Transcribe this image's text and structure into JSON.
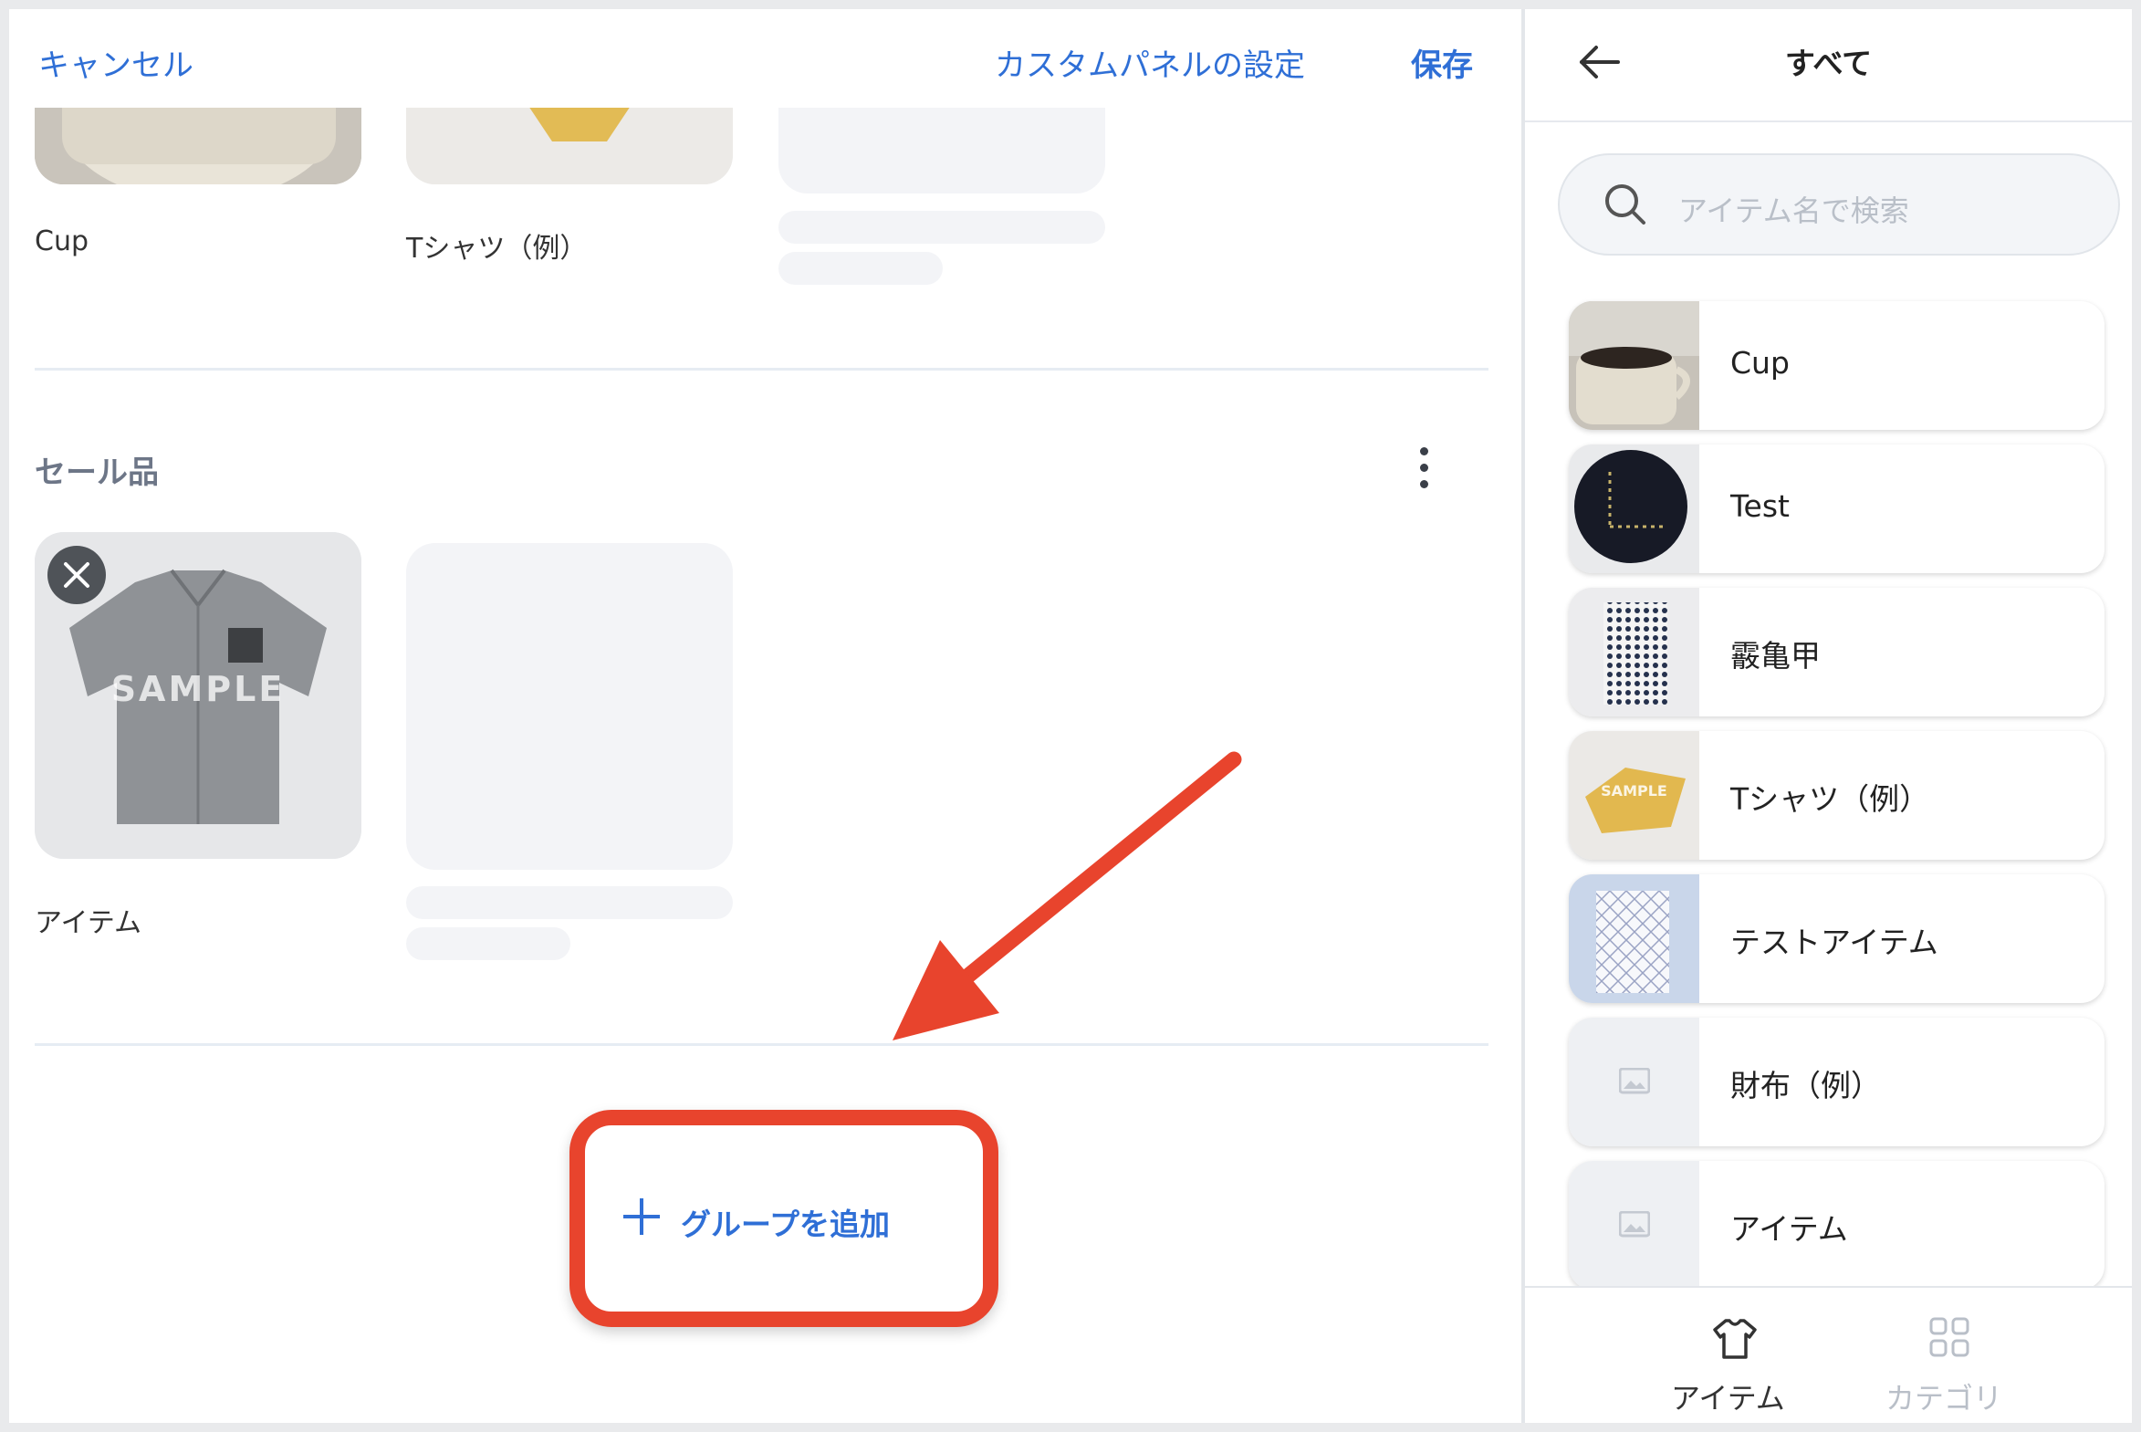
{
  "header": {
    "cancel_label": "キャンセル",
    "title": "カスタムパネルの設定",
    "save_label": "保存"
  },
  "top_row": {
    "items": [
      {
        "label": "Cup"
      },
      {
        "label": "Tシャツ（例）"
      }
    ]
  },
  "group": {
    "title": "セール品",
    "items": [
      {
        "label": "アイテム",
        "image_text": "SAMPLE"
      }
    ]
  },
  "add_group": {
    "label": "グループを追加"
  },
  "right_panel": {
    "title": "すべて",
    "search_placeholder": "アイテム名で検索",
    "items": [
      {
        "label": "Cup"
      },
      {
        "label": "Test"
      },
      {
        "label": "霰亀甲"
      },
      {
        "label": "Tシャツ（例）",
        "image_text": "SAMPLE"
      },
      {
        "label": "テストアイテム"
      },
      {
        "label": "財布（例）"
      },
      {
        "label": "アイテム"
      }
    ],
    "tabs": [
      {
        "label": "アイテム",
        "active": true
      },
      {
        "label": "カテゴリ",
        "active": false
      }
    ]
  },
  "colors": {
    "accent": "#2f6fd6",
    "annotation": "#e8442d",
    "inactive_tab": "#b9bfc8"
  },
  "icons": {
    "back": "arrow-left-icon",
    "search": "search-icon",
    "more": "kebab-icon",
    "remove": "close-icon",
    "add": "plus-icon",
    "item_tab": "tshirt-icon",
    "category_tab": "grid-icon",
    "placeholder": "image-placeholder-icon"
  }
}
